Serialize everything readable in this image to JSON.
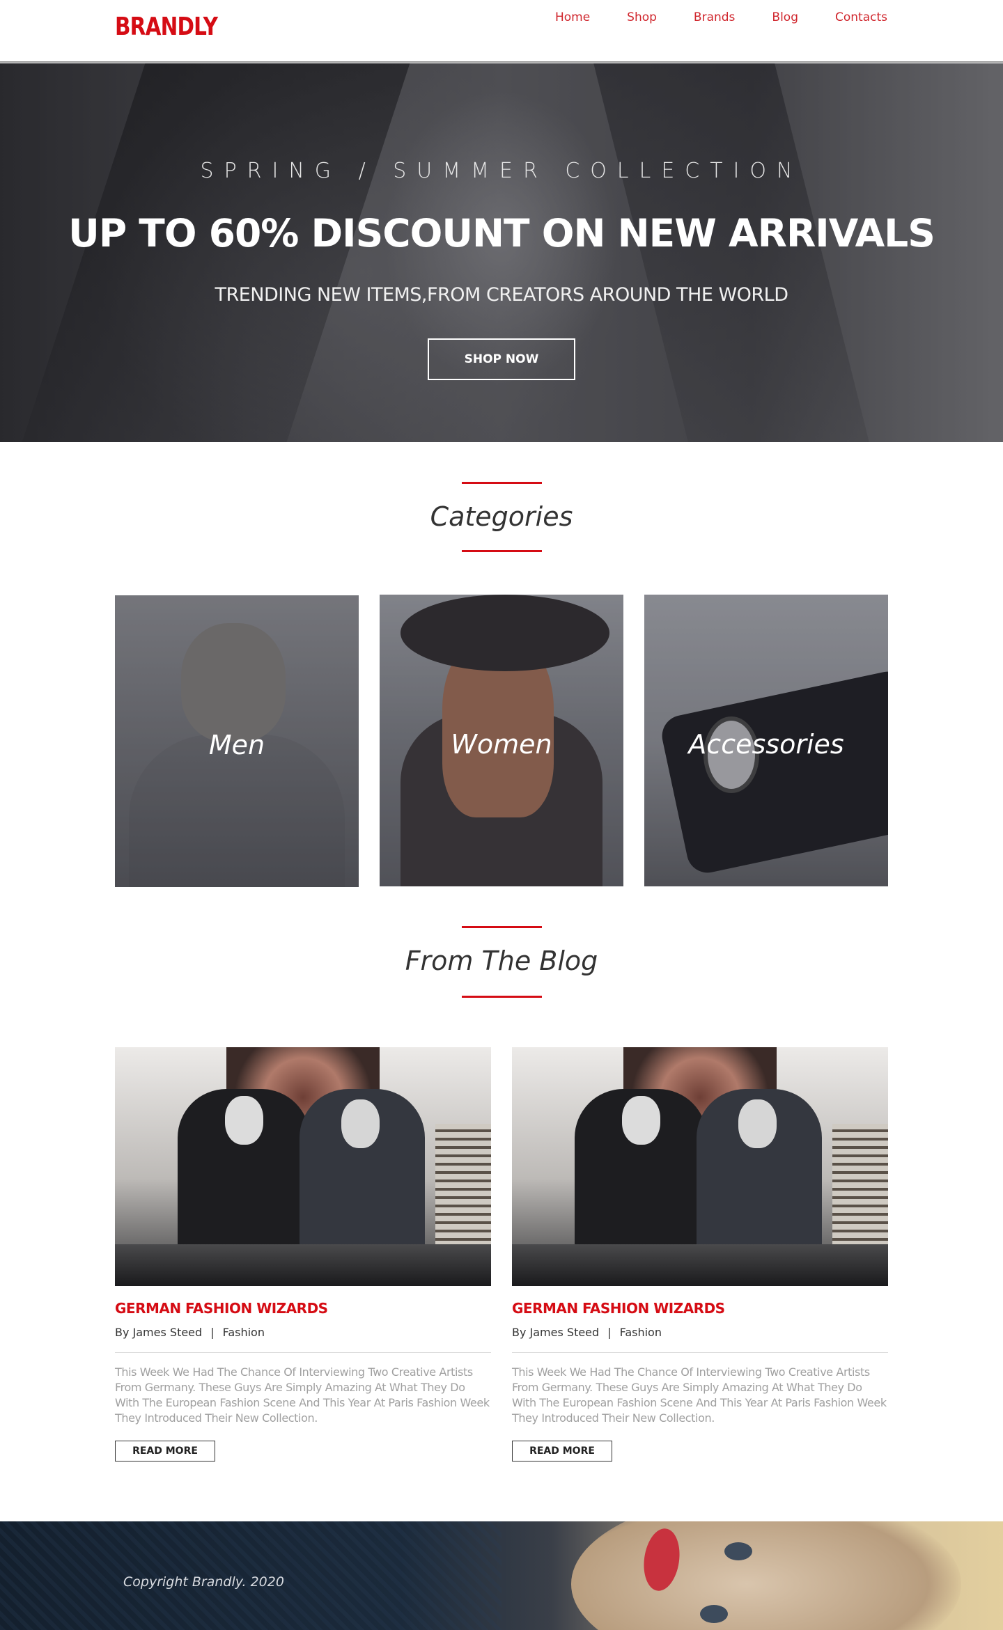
{
  "brand": {
    "logo": "BRANDLY",
    "accent_color": "#d50c14"
  },
  "nav": [
    {
      "label": "Home"
    },
    {
      "label": "Shop"
    },
    {
      "label": "Brands"
    },
    {
      "label": "Blog"
    },
    {
      "label": "Contacts"
    }
  ],
  "hero": {
    "subtitle": "SPRING / SUMMER COLLECTION",
    "title": "UP TO 60% DISCOUNT ON NEW ARRIVALS",
    "tagline": "TRENDING NEW ITEMS,FROM CREATORS AROUND THE WORLD",
    "button_label": "SHOP NOW"
  },
  "categories": {
    "heading": "Categories",
    "items": [
      {
        "label": "Men"
      },
      {
        "label": "Women"
      },
      {
        "label": "Accessories"
      }
    ]
  },
  "blog": {
    "heading": "From The Blog",
    "posts": [
      {
        "title": "GERMAN FASHION WIZARDS",
        "author": "By James Steed",
        "separator": "|",
        "category": "Fashion",
        "body": "This Week We Had The Chance Of Interviewing Two Creative Artists From Germany. These Guys Are Simply Amazing At What They Do With The   European Fashion Scene And This Year At Paris Fashion Week They   Introduced Their New Collection.",
        "button_label": "READ MORE"
      },
      {
        "title": "GERMAN FASHION WIZARDS",
        "author": "By James Steed",
        "separator": "|",
        "category": "Fashion",
        "body": "This Week We Had The Chance Of Interviewing Two Creative Artists From Germany. These Guys Are Simply Amazing At What They Do With The   European Fashion Scene And This Year At Paris Fashion Week They   Introduced Their New Collection.",
        "button_label": "READ MORE"
      }
    ]
  },
  "footer": {
    "copyright": "Copyright Brandly. 2020"
  }
}
